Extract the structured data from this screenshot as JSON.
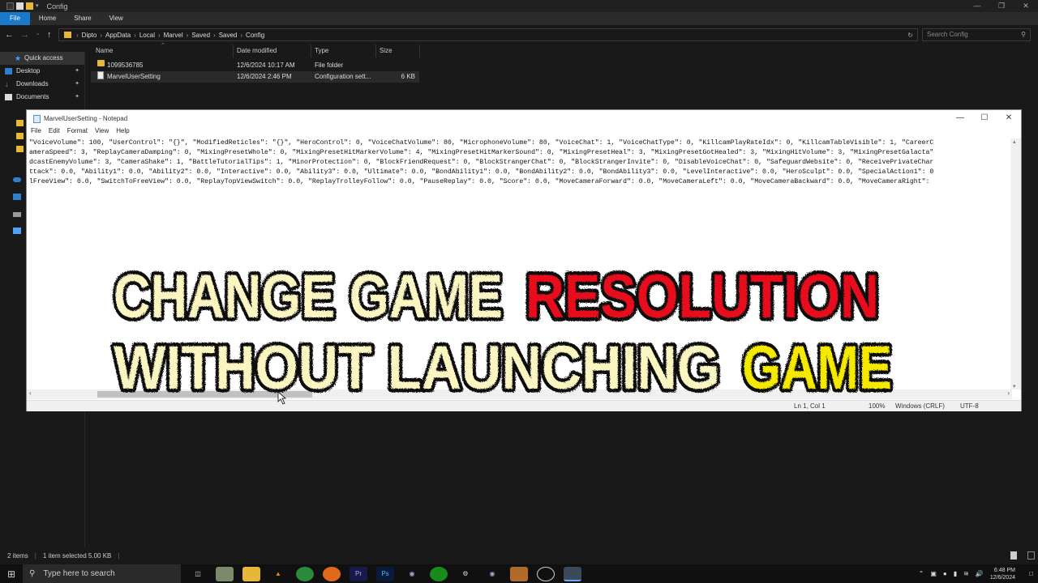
{
  "explorer": {
    "window_title": "Config",
    "ribbon_tabs": [
      "File",
      "Home",
      "Share",
      "View"
    ],
    "breadcrumbs": [
      "Dipto",
      "AppData",
      "Local",
      "Marvel",
      "Saved",
      "Saved",
      "Config"
    ],
    "search_placeholder": "Search Config",
    "sidebar": [
      {
        "label": "Quick access"
      },
      {
        "label": "Desktop"
      },
      {
        "label": "Downloads"
      },
      {
        "label": "Documents"
      }
    ],
    "columns": [
      "Name",
      "Date modified",
      "Type",
      "Size"
    ],
    "rows": [
      {
        "name": "1099536785",
        "date": "12/6/2024 10:17 AM",
        "type": "File folder",
        "size": ""
      },
      {
        "name": "MarvelUserSetting",
        "date": "12/6/2024 2:46 PM",
        "type": "Configuration sett...",
        "size": "6 KB"
      }
    ],
    "status": {
      "items": "2 items",
      "selected": "1 item selected  5.00 KB"
    }
  },
  "notepad": {
    "title": "MarvelUserSetting - Notepad",
    "menu": [
      "File",
      "Edit",
      "Format",
      "View",
      "Help"
    ],
    "lines": [
      "\"VoiceVolume\": 100, \"UserControl\": \"{}\", \"ModifiedReticles\": \"{}\", \"HeroControl\": 0, \"VoiceChatVolume\": 80, \"MicrophoneVolume\": 80, \"VoiceChat\": 1, \"VoiceChatType\": 0, \"KillcamPlayRateIdx\": 0, \"KillcamTableVisible\": 1, \"CareerC",
      "ameraSpeed\": 3, \"ReplayCameraDamping\": 0, \"MixingPresetWhole\": 0, \"MixingPresetHitMarkerVolume\": 4, \"MixingPresetHitMarkerSound\": 0, \"MixingPresetHeal\": 3, \"MixingPresetGotHealed\": 3, \"MixingHitVolume\": 3, \"MixingPresetGalacta\"",
      "dcastEnemyVolume\": 3, \"CameraShake\": 1, \"BattleTutorialTips\": 1, \"MinorProtection\": 0, \"BlockFriendRequest\": 0, \"BlockStrangerChat\": 0, \"BlockStrangerInvite\": 0, \"DisableVoiceChat\": 0, \"SafeguardWebsite\": 0, \"ReceivePrivateChar",
      "ttack\": 0.0, \"Ability1\": 0.0, \"Ability2\": 0.0, \"Interactive\": 0.0, \"Ability3\": 0.0, \"Ultimate\": 0.0, \"BondAbility1\": 0.0, \"BondAbility2\": 0.0, \"BondAbility3\": 0.0, \"LevelInteractive\": 0.0, \"HeroSculpt\": 0.0, \"SpecialAction1\": 0",
      "lFreeView\": 0.0, \"SwitchToFreeView\": 0.0, \"ReplayTopViewSwitch\": 0.0, \"ReplayTrolleyFollow\": 0.0, \"PauseReplay\": 0.0, \"Score\": 0.0, \"MoveCameraForward\": 0.0, \"MoveCameraLeft\": 0.0, \"MoveCameraBackward\": 0.0, \"MoveCameraRight\":"
    ],
    "status": {
      "position": "Ln 1, Col 1",
      "zoom": "100%",
      "eol": "Windows (CRLF)",
      "encoding": "UTF-8"
    }
  },
  "overlay": {
    "line1a": "CHANGE GAME",
    "line1b": "RESOLUTION",
    "line2a": "WITHOUT LAUNCHING",
    "line2b": "GAME",
    "colors": {
      "cream": "#fbf5c2",
      "red": "#e8101a",
      "yellow": "#f5e900"
    }
  },
  "taskbar": {
    "search_placeholder": "Type here to search",
    "apps": [
      "Task View",
      "App",
      "File Explorer",
      "VLC",
      "Chrome",
      "Firefox",
      "Premiere Pro",
      "Photoshop",
      "Steam",
      "Xbox",
      "Settings",
      "Steam",
      "Game",
      "App",
      "Notepad"
    ],
    "time": "6:48 PM",
    "date": "12/6/2024"
  }
}
